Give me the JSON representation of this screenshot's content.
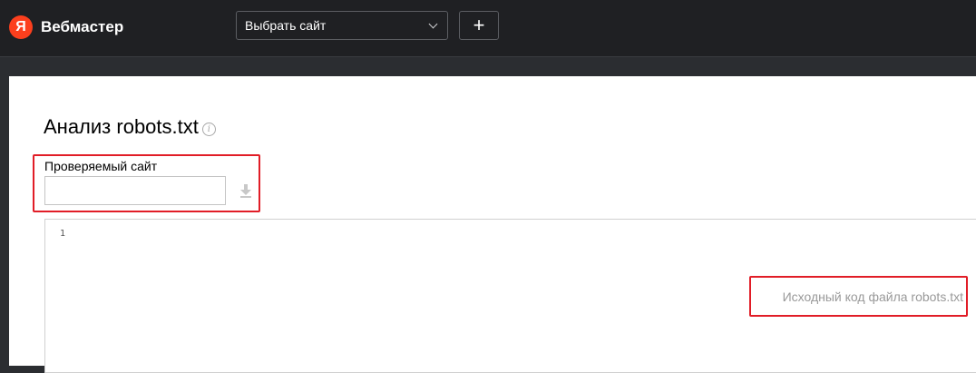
{
  "header": {
    "logo_letter": "Я",
    "brand": "Вебмастер",
    "site_select": "Выбрать сайт",
    "add_label": "+"
  },
  "page": {
    "title": "Анализ robots.txt",
    "info_glyph": "i",
    "site_label": "Проверяемый сайт",
    "site_input_value": "",
    "editor": {
      "line_number": "1",
      "placeholder": "Исходный код файла robots.txt"
    }
  },
  "colors": {
    "header_bg": "#1f2023",
    "brand_red": "#fc3f1d",
    "highlight": "#e11d27"
  }
}
